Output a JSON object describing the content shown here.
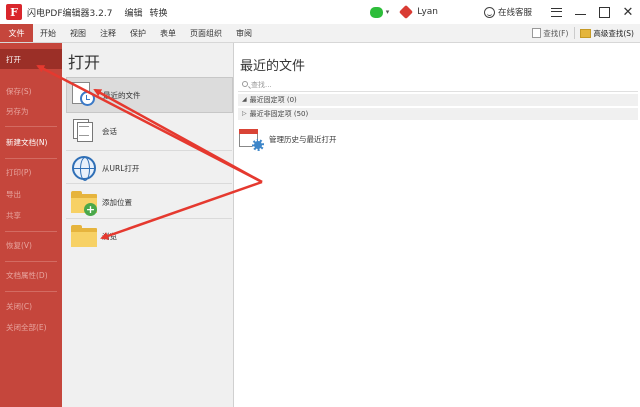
{
  "app": {
    "logo": "F",
    "title": "闪电PDF编辑器3.2.7"
  },
  "title_menu": [
    "编辑",
    "转换"
  ],
  "user": {
    "name": "Lyan"
  },
  "service_label": "在线客服",
  "ribbon_tabs": [
    "文件",
    "开始",
    "视图",
    "注释",
    "保护",
    "表单",
    "页面组织",
    "审阅"
  ],
  "ribbon_right": {
    "find_label": "查找(F)",
    "advanced_find_label": "高级查找(S)"
  },
  "sidebar": {
    "open": "打开",
    "save": "保存(S)",
    "save_as": "另存为",
    "new_doc": "新建文档(N)",
    "print": "打印(P)",
    "export": "导出",
    "share": "共享",
    "revert": "恢复(V)",
    "properties": "文档属性(D)",
    "close": "关闭(C)",
    "close_all": "关闭全部(E)"
  },
  "open_panel": {
    "title": "打开",
    "items": [
      "最近的文件",
      "会话",
      "从URL打开",
      "添加位置",
      "浏览"
    ]
  },
  "recent": {
    "title": "最近的文件",
    "search_placeholder": "查找...",
    "pinned": "最近固定项 (0)",
    "unpinned": "最近非固定项 (50)",
    "manage": "管理历史与最近打开"
  },
  "colors": {
    "accent": "#c5463c",
    "arrow": "#e5392f"
  },
  "icons": {
    "logo": "app-logo-icon",
    "recent": "clock-icon",
    "session": "session-icon",
    "url": "globe-icon",
    "add_location": "folder-add-icon",
    "browse": "folder-icon",
    "manage": "calendar-gear-icon"
  }
}
